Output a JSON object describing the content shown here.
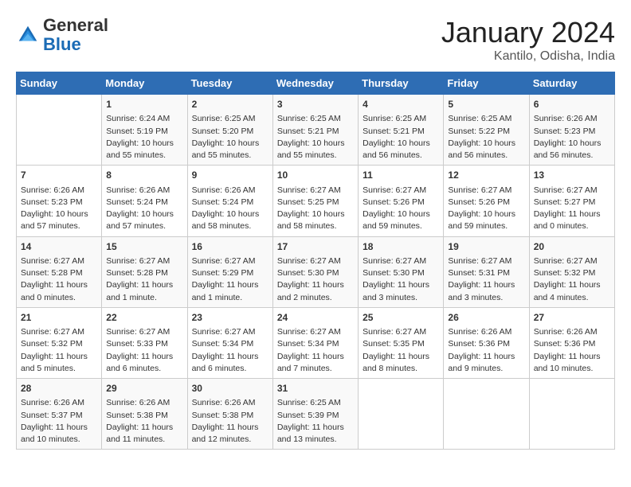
{
  "header": {
    "logo_general": "General",
    "logo_blue": "Blue",
    "title": "January 2024",
    "subtitle": "Kantilo, Odisha, India"
  },
  "days_of_week": [
    "Sunday",
    "Monday",
    "Tuesday",
    "Wednesday",
    "Thursday",
    "Friday",
    "Saturday"
  ],
  "weeks": [
    [
      {
        "day": "",
        "info": ""
      },
      {
        "day": "1",
        "info": "Sunrise: 6:24 AM\nSunset: 5:19 PM\nDaylight: 10 hours\nand 55 minutes."
      },
      {
        "day": "2",
        "info": "Sunrise: 6:25 AM\nSunset: 5:20 PM\nDaylight: 10 hours\nand 55 minutes."
      },
      {
        "day": "3",
        "info": "Sunrise: 6:25 AM\nSunset: 5:21 PM\nDaylight: 10 hours\nand 55 minutes."
      },
      {
        "day": "4",
        "info": "Sunrise: 6:25 AM\nSunset: 5:21 PM\nDaylight: 10 hours\nand 56 minutes."
      },
      {
        "day": "5",
        "info": "Sunrise: 6:25 AM\nSunset: 5:22 PM\nDaylight: 10 hours\nand 56 minutes."
      },
      {
        "day": "6",
        "info": "Sunrise: 6:26 AM\nSunset: 5:23 PM\nDaylight: 10 hours\nand 56 minutes."
      }
    ],
    [
      {
        "day": "7",
        "info": "Sunrise: 6:26 AM\nSunset: 5:23 PM\nDaylight: 10 hours\nand 57 minutes."
      },
      {
        "day": "8",
        "info": "Sunrise: 6:26 AM\nSunset: 5:24 PM\nDaylight: 10 hours\nand 57 minutes."
      },
      {
        "day": "9",
        "info": "Sunrise: 6:26 AM\nSunset: 5:24 PM\nDaylight: 10 hours\nand 58 minutes."
      },
      {
        "day": "10",
        "info": "Sunrise: 6:27 AM\nSunset: 5:25 PM\nDaylight: 10 hours\nand 58 minutes."
      },
      {
        "day": "11",
        "info": "Sunrise: 6:27 AM\nSunset: 5:26 PM\nDaylight: 10 hours\nand 59 minutes."
      },
      {
        "day": "12",
        "info": "Sunrise: 6:27 AM\nSunset: 5:26 PM\nDaylight: 10 hours\nand 59 minutes."
      },
      {
        "day": "13",
        "info": "Sunrise: 6:27 AM\nSunset: 5:27 PM\nDaylight: 11 hours\nand 0 minutes."
      }
    ],
    [
      {
        "day": "14",
        "info": "Sunrise: 6:27 AM\nSunset: 5:28 PM\nDaylight: 11 hours\nand 0 minutes."
      },
      {
        "day": "15",
        "info": "Sunrise: 6:27 AM\nSunset: 5:28 PM\nDaylight: 11 hours\nand 1 minute."
      },
      {
        "day": "16",
        "info": "Sunrise: 6:27 AM\nSunset: 5:29 PM\nDaylight: 11 hours\nand 1 minute."
      },
      {
        "day": "17",
        "info": "Sunrise: 6:27 AM\nSunset: 5:30 PM\nDaylight: 11 hours\nand 2 minutes."
      },
      {
        "day": "18",
        "info": "Sunrise: 6:27 AM\nSunset: 5:30 PM\nDaylight: 11 hours\nand 3 minutes."
      },
      {
        "day": "19",
        "info": "Sunrise: 6:27 AM\nSunset: 5:31 PM\nDaylight: 11 hours\nand 3 minutes."
      },
      {
        "day": "20",
        "info": "Sunrise: 6:27 AM\nSunset: 5:32 PM\nDaylight: 11 hours\nand 4 minutes."
      }
    ],
    [
      {
        "day": "21",
        "info": "Sunrise: 6:27 AM\nSunset: 5:32 PM\nDaylight: 11 hours\nand 5 minutes."
      },
      {
        "day": "22",
        "info": "Sunrise: 6:27 AM\nSunset: 5:33 PM\nDaylight: 11 hours\nand 6 minutes."
      },
      {
        "day": "23",
        "info": "Sunrise: 6:27 AM\nSunset: 5:34 PM\nDaylight: 11 hours\nand 6 minutes."
      },
      {
        "day": "24",
        "info": "Sunrise: 6:27 AM\nSunset: 5:34 PM\nDaylight: 11 hours\nand 7 minutes."
      },
      {
        "day": "25",
        "info": "Sunrise: 6:27 AM\nSunset: 5:35 PM\nDaylight: 11 hours\nand 8 minutes."
      },
      {
        "day": "26",
        "info": "Sunrise: 6:26 AM\nSunset: 5:36 PM\nDaylight: 11 hours\nand 9 minutes."
      },
      {
        "day": "27",
        "info": "Sunrise: 6:26 AM\nSunset: 5:36 PM\nDaylight: 11 hours\nand 10 minutes."
      }
    ],
    [
      {
        "day": "28",
        "info": "Sunrise: 6:26 AM\nSunset: 5:37 PM\nDaylight: 11 hours\nand 10 minutes."
      },
      {
        "day": "29",
        "info": "Sunrise: 6:26 AM\nSunset: 5:38 PM\nDaylight: 11 hours\nand 11 minutes."
      },
      {
        "day": "30",
        "info": "Sunrise: 6:26 AM\nSunset: 5:38 PM\nDaylight: 11 hours\nand 12 minutes."
      },
      {
        "day": "31",
        "info": "Sunrise: 6:25 AM\nSunset: 5:39 PM\nDaylight: 11 hours\nand 13 minutes."
      },
      {
        "day": "",
        "info": ""
      },
      {
        "day": "",
        "info": ""
      },
      {
        "day": "",
        "info": ""
      }
    ]
  ]
}
